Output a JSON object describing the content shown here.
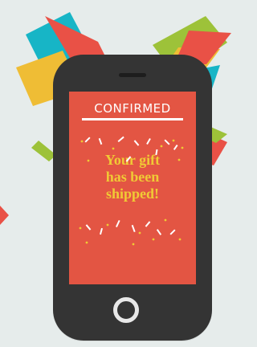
{
  "scene": {
    "background_color": "#e6eceb",
    "phone_color": "#343434",
    "screen_color": "#e35543",
    "accent_color": "#f0ca35"
  },
  "screen": {
    "headline": "CONFIRMED",
    "message_lines": [
      "Your gift",
      "has been",
      "shipped!"
    ]
  }
}
